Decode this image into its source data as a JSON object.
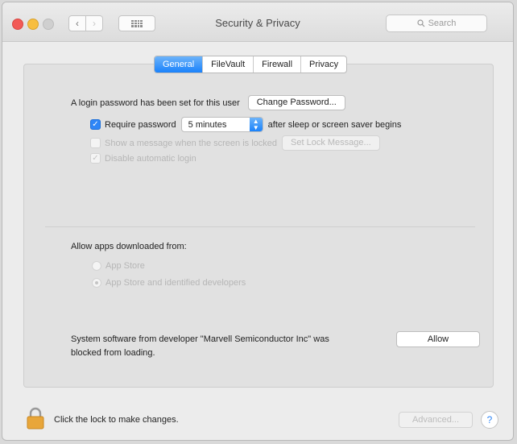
{
  "window": {
    "title": "Security & Privacy"
  },
  "toolbar": {
    "search_placeholder": "Search"
  },
  "tabs": [
    {
      "label": "General",
      "active": true
    },
    {
      "label": "FileVault",
      "active": false
    },
    {
      "label": "Firewall",
      "active": false
    },
    {
      "label": "Privacy",
      "active": false
    }
  ],
  "general": {
    "login_password_text": "A login password has been set for this user",
    "change_password_label": "Change Password...",
    "require_password_label": "Require password",
    "require_password_checked": true,
    "require_password_interval": "5 minutes",
    "after_sleep_text": "after sleep or screen saver begins",
    "show_message_label": "Show a message when the screen is locked",
    "set_lock_message_label": "Set Lock Message...",
    "disable_auto_login_label": "Disable automatic login",
    "allow_apps_heading": "Allow apps downloaded from:",
    "app_store_option": "App Store",
    "app_store_identified_option": "App Store and identified developers",
    "blocked_line1": "System software from developer \"Marvell Semiconductor Inc\" was",
    "blocked_line2": "blocked from loading.",
    "allow_label": "Allow"
  },
  "footer": {
    "lock_text": "Click the lock to make changes.",
    "advanced_label": "Advanced...",
    "help_label": "?"
  },
  "colors": {
    "accent": "#1a82fb",
    "lock": "#e8a63a"
  }
}
